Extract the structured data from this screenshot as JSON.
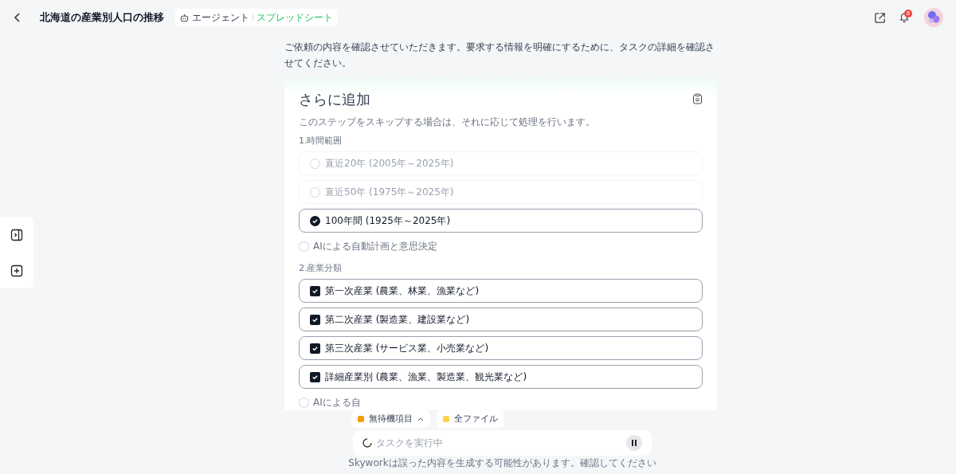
{
  "header": {
    "title": "北海道の産業別人口の推移",
    "mode_tabs": [
      {
        "label": "エージェント",
        "selected": false
      },
      {
        "label": "スプレッドシート",
        "selected": true
      }
    ],
    "notification_count": "8"
  },
  "message": "ご依頼の内容を確認させていただきます。要求する情報を明確にするために、タスクの詳細を確認させてください。",
  "card": {
    "title": "さらに追加",
    "note": "このステップをスキップする場合は、それに応じて処理を行います。",
    "sections": [
      {
        "label": "1.時間範囲",
        "options": [
          {
            "kind": "radio",
            "label": "直近20年 (2005年～2025年)",
            "selected": false
          },
          {
            "kind": "radio",
            "label": "直近50年 (1975年～2025年)",
            "selected": false
          },
          {
            "kind": "radio",
            "label": "100年間 (1925年～2025年)",
            "selected": true
          },
          {
            "kind": "auto",
            "label": "AIによる自動計画と意思決定",
            "selected": false
          }
        ]
      },
      {
        "label": "2.産業分類",
        "options": [
          {
            "kind": "checkbox",
            "label": "第一次産業 (農業、林業、漁業など)",
            "selected": true
          },
          {
            "kind": "checkbox",
            "label": "第二次産業 (製造業、建設業など)",
            "selected": true
          },
          {
            "kind": "checkbox",
            "label": "第三次産業 (サービス業、小売業など)",
            "selected": true
          },
          {
            "kind": "checkbox",
            "label": "詳細産業別 (農業、漁業、製造業、観光業など)",
            "selected": true
          },
          {
            "kind": "auto",
            "label": "AIによる自",
            "selected": false
          }
        ]
      }
    ]
  },
  "chips": [
    {
      "label": "無待機項目",
      "color": "#f59e0b"
    },
    {
      "label": "全ファイル",
      "color": "#fcd34d"
    }
  ],
  "input": {
    "placeholder": "タスクを実行中"
  },
  "disclaimer": "Skyworkは誤った内容を生成する可能性があります。確認してください"
}
